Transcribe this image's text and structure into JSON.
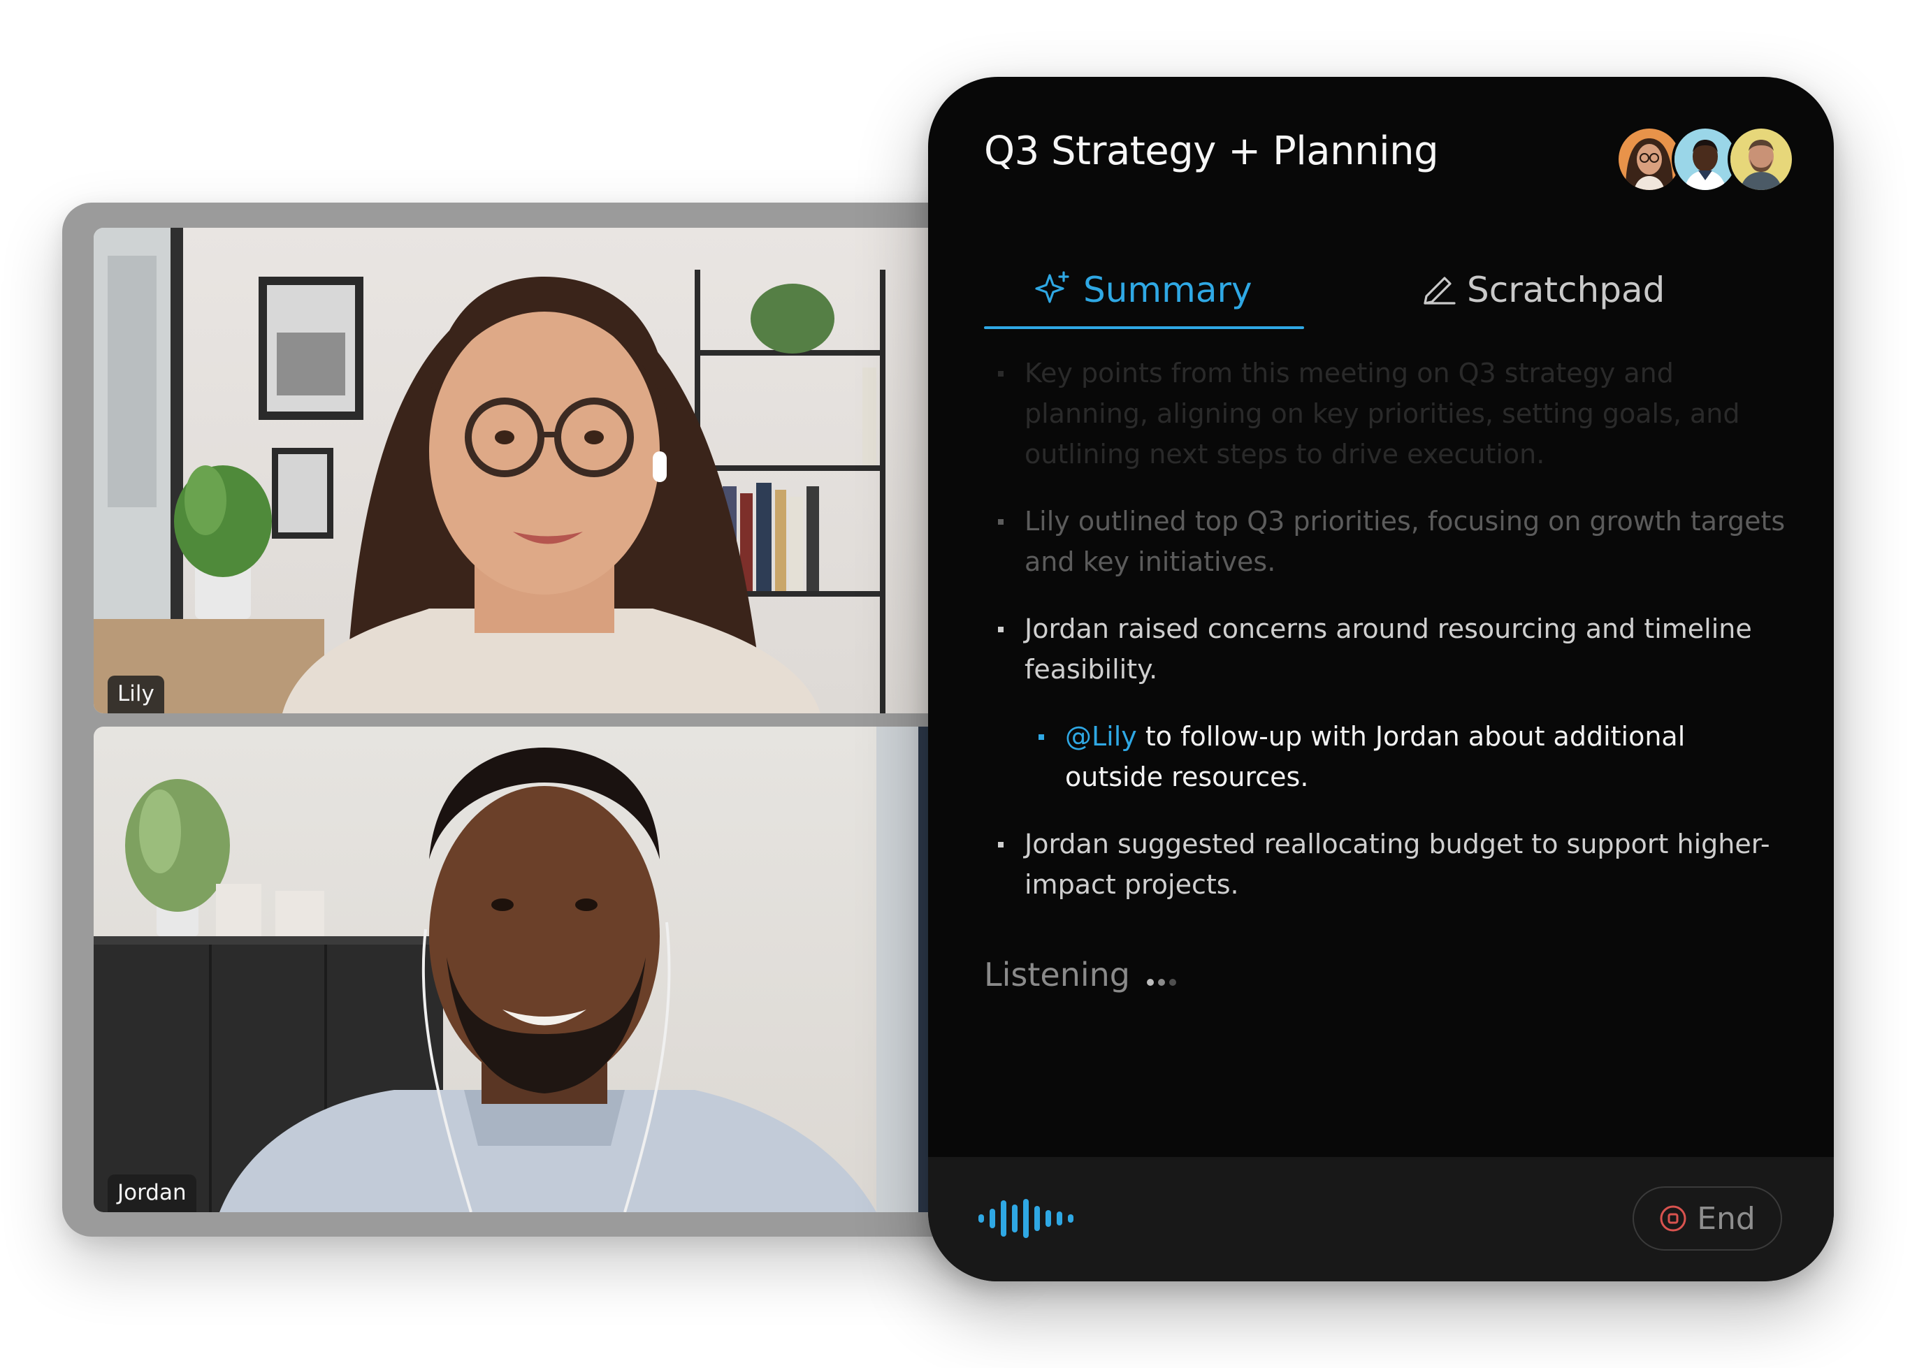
{
  "meeting": {
    "title": "Q3 Strategy + Planning"
  },
  "participants": [
    {
      "name": "Lily"
    },
    {
      "name": "Jordan"
    }
  ],
  "avatars": [
    {
      "icon": "participant-avatar-woman-glasses",
      "ring_color": "#e8934a"
    },
    {
      "icon": "participant-avatar-man-dark-skin",
      "ring_color": "#9ad6e8"
    },
    {
      "icon": "participant-avatar-man-beard",
      "ring_color": "#e7d77a"
    }
  ],
  "tabs": [
    {
      "label": "Summary",
      "icon": "sparkle-icon",
      "active": true
    },
    {
      "label": "Scratchpad",
      "icon": "pencil-icon",
      "active": false
    }
  ],
  "summary": {
    "items": [
      {
        "text": "Key points from this meeting on Q3 strategy and planning, aligning on key priorities, setting goals, and outlining next steps to drive execution."
      },
      {
        "text": "Lily outlined top Q3 priorities, focusing on growth targets and key initiatives."
      },
      {
        "text": "Jordan raised concerns around resourcing and timeline feasibility."
      },
      {
        "mention": "@Lily",
        "text": " to follow-up with Jordan about additional outside resources."
      },
      {
        "text": "Jordan suggested reallocating budget to support higher-impact projects."
      }
    ]
  },
  "status": {
    "listening_label": "Listening"
  },
  "footer": {
    "end_label": "End",
    "waveform_icon": "audio-waveform-icon"
  },
  "colors": {
    "accent": "#2fa8e4",
    "panel_bg": "#080808",
    "footer_bg": "#181818",
    "end_icon": "#d9534f"
  }
}
